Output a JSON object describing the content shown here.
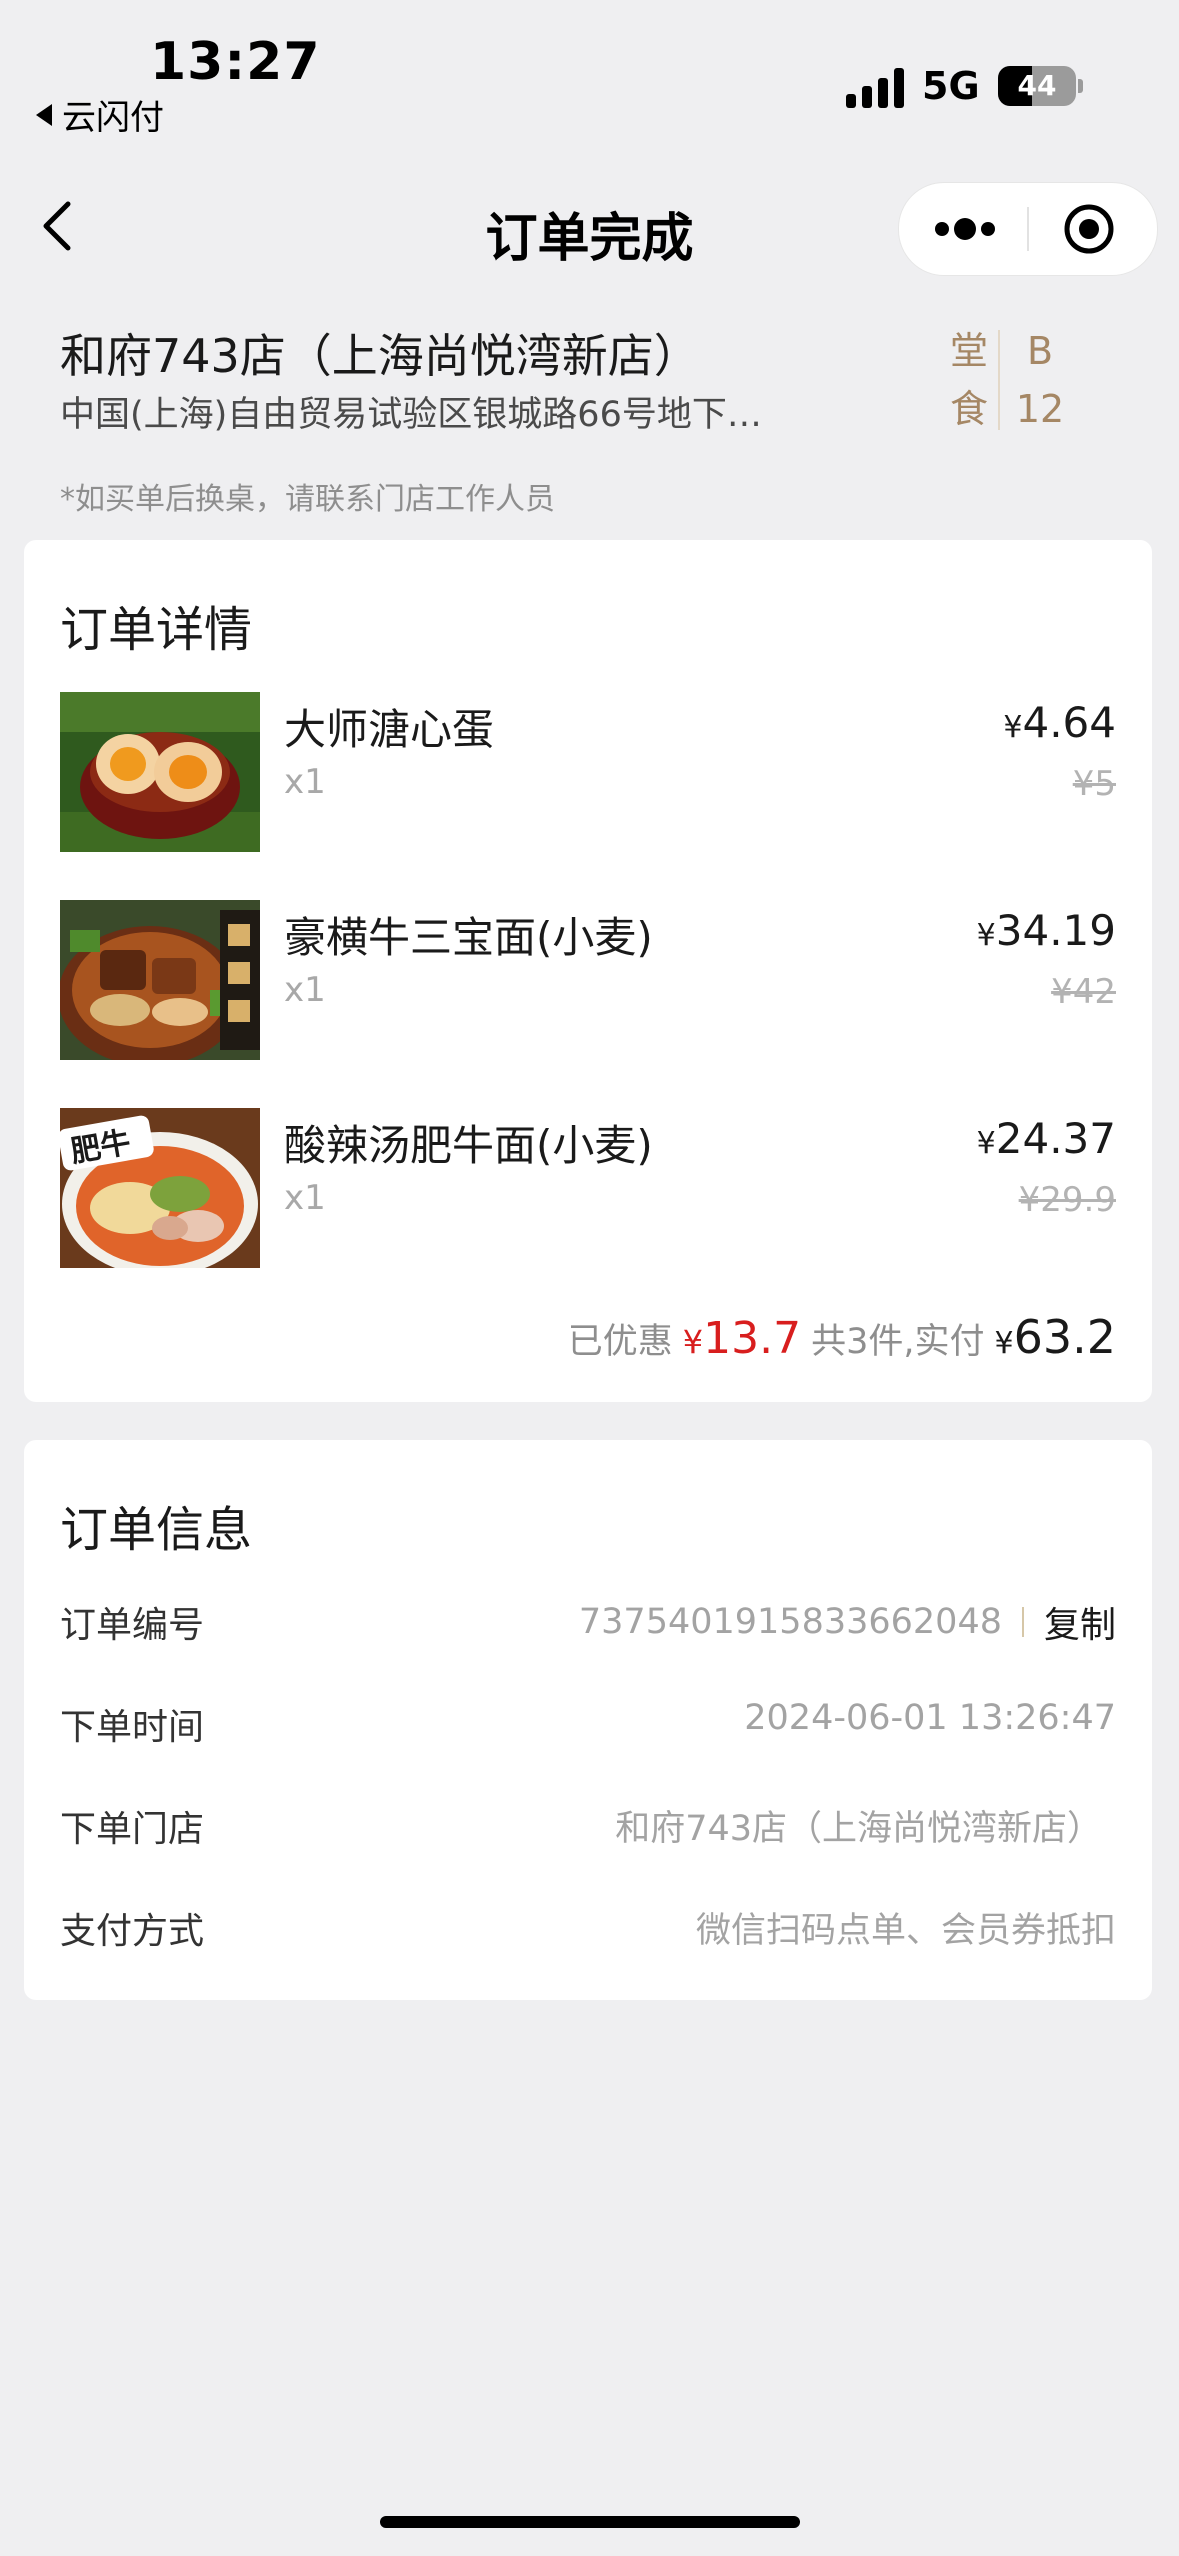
{
  "status_bar": {
    "time": "13:27",
    "back_app": "云闪付",
    "network": "5G",
    "battery": "44",
    "battery_level": 0.44
  },
  "nav": {
    "title": "订单完成"
  },
  "store": {
    "name": "和府743店（上海尚悦湾新店）",
    "address": "中国(上海)自由贸易试验区银城路66号地下…",
    "dine_type": [
      "堂",
      "食"
    ],
    "table_no": [
      "B",
      "12"
    ],
    "note": "*如买单后换桌，请联系门店工作人员"
  },
  "order_detail": {
    "title": "订单详情",
    "items": [
      {
        "name": "大师溏心蛋",
        "qty": "x1",
        "currency": "¥",
        "price": "4.64",
        "original": "¥5"
      },
      {
        "name": "豪横牛三宝面(小麦)",
        "qty": "x1",
        "currency": "¥",
        "price": "34.19",
        "original": "¥42"
      },
      {
        "name": "酸辣汤肥牛面(小麦)",
        "qty": "x1",
        "currency": "¥",
        "price": "24.37",
        "original": "¥29.9"
      }
    ],
    "summary": {
      "saved_label": "已优惠",
      "saved_currency": "¥",
      "saved_value": "13.7",
      "count_label": "共3件,实付",
      "total_currency": "¥",
      "total_value": "63.2"
    },
    "thumb_labels": {
      "noodle2": "肥牛"
    }
  },
  "order_info": {
    "title": "订单信息",
    "rows": [
      {
        "label": "订单编号",
        "value": "7375401915833662048",
        "action": "复制"
      },
      {
        "label": "下单时间",
        "value": "2024-06-01 13:26:47"
      },
      {
        "label": "下单门店",
        "value": "和府743店（上海尚悦湾新店）"
      },
      {
        "label": "支付方式",
        "value": "微信扫码点单、会员券抵扣"
      }
    ]
  },
  "colors": {
    "accent_gold": "#a58765",
    "discount_red": "#d81e1e",
    "background": "#efeff1"
  }
}
